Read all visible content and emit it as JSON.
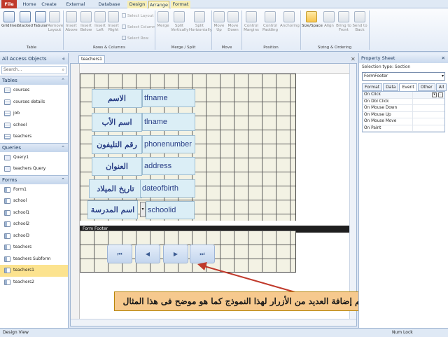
{
  "ribbon_tabs": [
    "File",
    "Home",
    "Create",
    "External Data",
    "Database Tools",
    "Design",
    "Arrange",
    "Format"
  ],
  "ribbon": {
    "table_group": {
      "label": "Table",
      "buttons": [
        "Gridlines",
        "Stacked",
        "Tabular",
        "Remove Layout"
      ]
    },
    "rows_cols_group": {
      "label": "Rows & Columns",
      "buttons": [
        "Insert Above",
        "Insert Below",
        "Insert Left",
        "Insert Right"
      ],
      "small": [
        "Select Layout",
        "Select Column",
        "Select Row"
      ]
    },
    "merge_group": {
      "label": "Merge / Split",
      "buttons": [
        "Merge",
        "Split Vertically",
        "Split Horizontally"
      ]
    },
    "move_group": {
      "label": "Move",
      "buttons": [
        "Move Up",
        "Move Down"
      ]
    },
    "position_group": {
      "label": "Position",
      "buttons": [
        "Control Margins",
        "Control Padding",
        "Anchoring"
      ]
    },
    "sizing_group": {
      "label": "Sizing & Ordering",
      "buttons": [
        "Size/Space",
        "Align",
        "Bring to Front",
        "Send to Back"
      ]
    }
  },
  "nav": {
    "title": "All Access Objects",
    "search_placeholder": "Search...",
    "sections": [
      {
        "name": "Tables",
        "items": [
          "courses",
          "courses details",
          "job",
          "school",
          "teachers"
        ]
      },
      {
        "name": "Queries",
        "items": [
          "Query1",
          "teachers Query"
        ]
      },
      {
        "name": "Forms",
        "items": [
          "Form1",
          "school",
          "school1",
          "school2",
          "school3",
          "teachers",
          "teachers Subform",
          "teachers1",
          "teachers2"
        ]
      }
    ],
    "selected": "teachers1"
  },
  "document_tab": "teachers1",
  "form": {
    "labels": [
      "الاسم",
      "اسم الأب",
      "رقم التليفون",
      "العنوان",
      "تاريخ الميلاد",
      "اسم المدرسة"
    ],
    "fields": [
      "tfname",
      "tlname",
      "phonenumber",
      "address",
      "dateofbirth",
      "schoolid"
    ],
    "footer_label": "Form Footer",
    "nav_buttons": [
      "first-record",
      "previous-record",
      "next-record",
      "last-record"
    ]
  },
  "callout": "تم إضافة العديد من الأزرار لهذا النموذج كما هو موضح فى هذا المثال",
  "property_sheet": {
    "title": "Property Sheet",
    "selection_type": "Selection type:  Section",
    "selected_object": "FormFooter",
    "tabs": [
      "Format",
      "Data",
      "Event",
      "Other",
      "All"
    ],
    "active_tab": "Event",
    "rows": [
      "On Click",
      "On Dbl Click",
      "On Mouse Down",
      "On Mouse Up",
      "On Mouse Move",
      "On Paint"
    ]
  },
  "status": {
    "left": "Design View",
    "right": "Num Lock"
  }
}
